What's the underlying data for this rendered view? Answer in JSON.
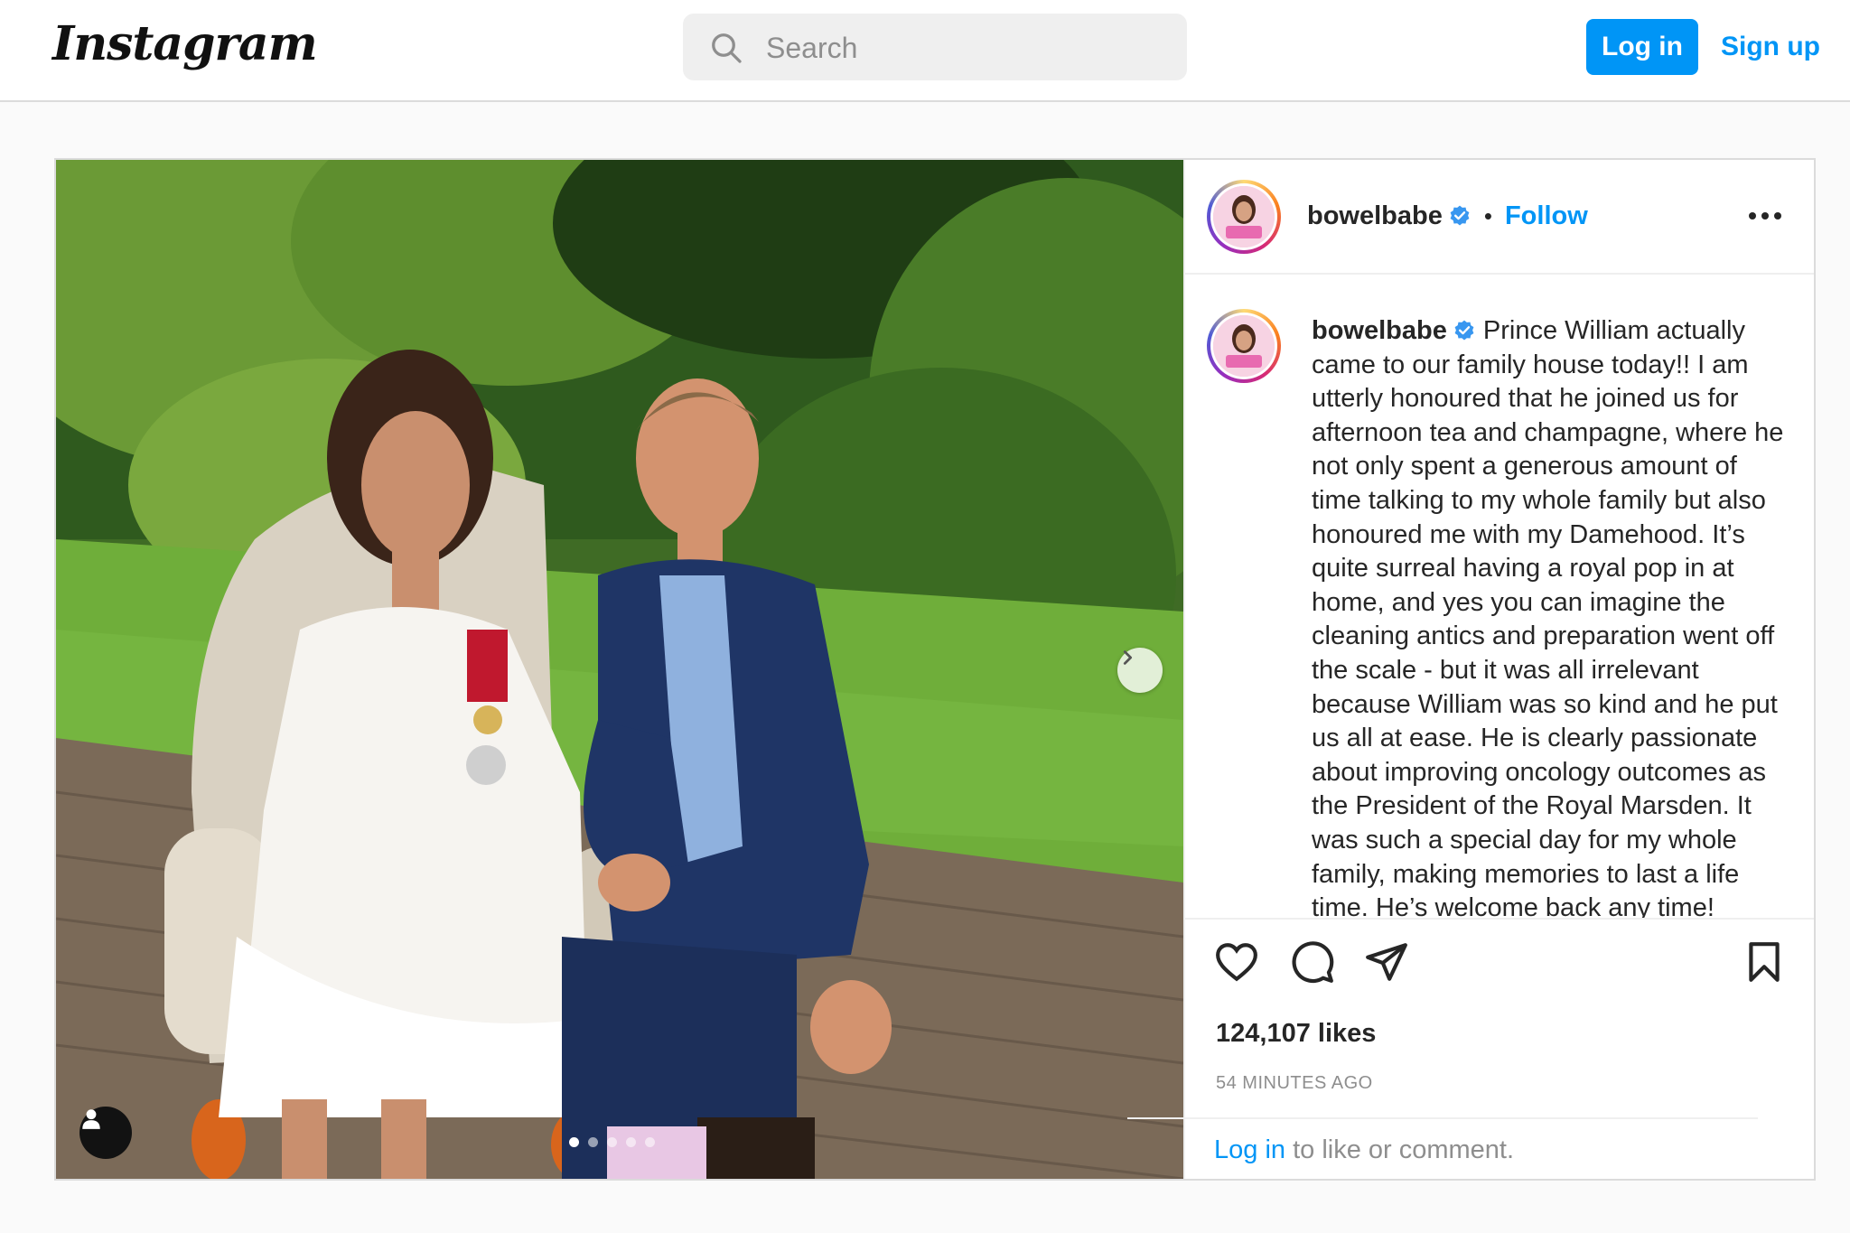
{
  "header": {
    "logo_text": "Instagram",
    "search_placeholder": "Search",
    "login_label": "Log in",
    "signup_label": "Sign up"
  },
  "post": {
    "username": "bowelbabe",
    "follow_label": "Follow",
    "separator": "•",
    "caption_text": "Prince William actually came to our family house today!! I am utterly honoured that he joined us for afternoon tea and champagne, where he not only spent a generous amount of time talking to my whole family but also honoured me with my Damehood. It’s quite surreal having a royal pop in at home, and yes you can imagine the cleaning antics and preparation went off the scale - but it was all irrelevant because William was so kind and he put us all at ease. He is clearly passionate about improving oncology outcomes as the President of the Royal Marsden. It was such a special day for my whole family, making memories to last a life time. He’s welcome back any time!",
    "likes": "124,107 likes",
    "time_ago": "54 MINUTES AGO",
    "login_prompt_link": "Log in",
    "login_prompt_text": " to like or comment.",
    "carousel_total": 5,
    "carousel_active": 1
  },
  "icons": {
    "search": "search-icon",
    "verified": "verified-badge-icon",
    "more": "more-options-icon",
    "like": "heart-icon",
    "comment": "comment-icon",
    "share": "share-icon",
    "save": "bookmark-icon",
    "next": "chevron-right-icon",
    "tag": "user-tag-icon"
  },
  "colors": {
    "accent": "#0095f6",
    "text": "#262626",
    "muted": "#8e8e8e",
    "border": "#dbdbdb"
  }
}
